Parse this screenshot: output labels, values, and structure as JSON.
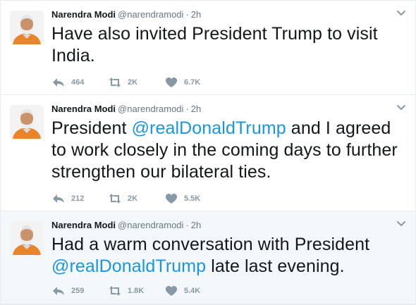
{
  "tweets": [
    {
      "author": {
        "name": "Narendra Modi",
        "handle": "@narendramodi"
      },
      "separator": "·",
      "time": "2h",
      "text_segments": [
        {
          "text": "Have also invited President Trump to visit India.",
          "mention": false
        }
      ],
      "replies": "464",
      "retweets": "2K",
      "likes": "6.7K"
    },
    {
      "author": {
        "name": "Narendra Modi",
        "handle": "@narendramodi"
      },
      "separator": "·",
      "time": "2h",
      "text_segments": [
        {
          "text": "President ",
          "mention": false
        },
        {
          "text": "@realDonaldTrump",
          "mention": true
        },
        {
          "text": " and I agreed to work closely in the coming days to further strengthen our bilateral ties.",
          "mention": false
        }
      ],
      "replies": "212",
      "retweets": "2K",
      "likes": "5.5K"
    },
    {
      "author": {
        "name": "Narendra Modi",
        "handle": "@narendramodi"
      },
      "separator": "·",
      "time": "2h",
      "text_segments": [
        {
          "text": "Had a warm conversation with President ",
          "mention": false
        },
        {
          "text": "@realDonaldTrump",
          "mention": true
        },
        {
          "text": " late last evening.",
          "mention": false
        }
      ],
      "replies": "259",
      "retweets": "1.8K",
      "likes": "5.4K"
    }
  ],
  "colors": {
    "text": "#14171a",
    "secondary": "#657786",
    "action": "#8899a6",
    "mention": "#1b95e0",
    "highlight_bg": "#f5f8fa"
  },
  "icons": {
    "avatar": "profile-photo",
    "caret": "chevron-down-icon",
    "reply": "reply-icon",
    "retweet": "retweet-icon",
    "like": "heart-icon"
  }
}
